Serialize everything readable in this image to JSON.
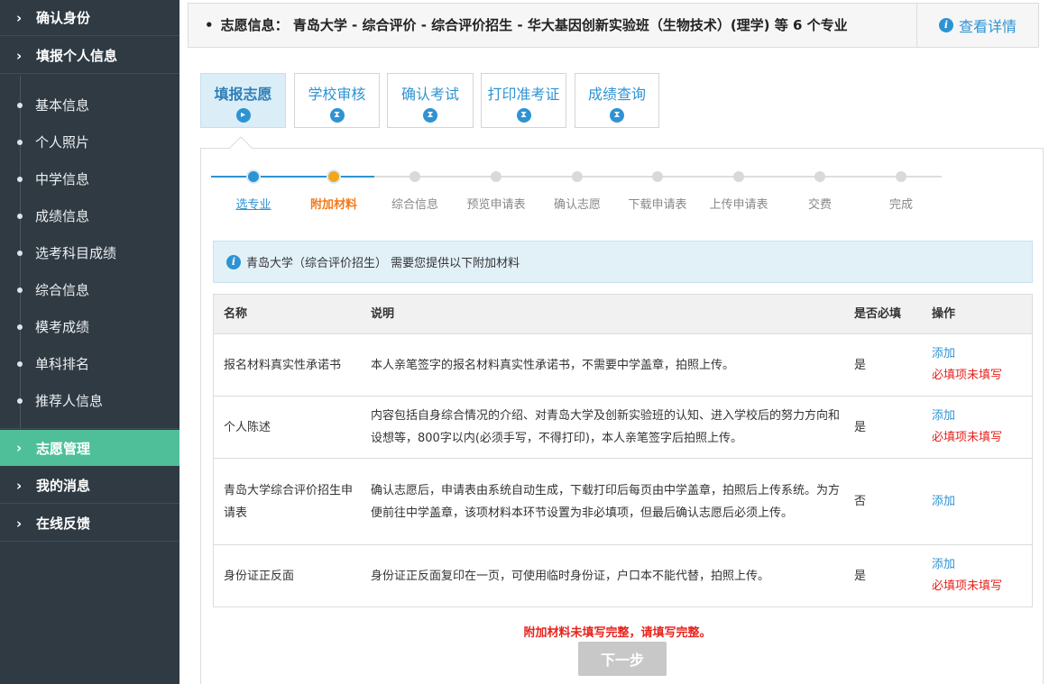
{
  "sidebar": {
    "sections": [
      {
        "label": "确认身份"
      },
      {
        "label": "填报个人信息"
      },
      {
        "label": "志愿管理",
        "active": true
      },
      {
        "label": "我的消息"
      },
      {
        "label": "在线反馈"
      }
    ],
    "sub_items": [
      {
        "label": "基本信息"
      },
      {
        "label": "个人照片"
      },
      {
        "label": "中学信息"
      },
      {
        "label": "成绩信息"
      },
      {
        "label": "选考科目成绩"
      },
      {
        "label": "综合信息"
      },
      {
        "label": "模考成绩"
      },
      {
        "label": "单科排名"
      },
      {
        "label": "推荐人信息"
      }
    ],
    "chevron": "›"
  },
  "info_bar": {
    "bullet": "•",
    "text": "志愿信息： 青岛大学 - 综合评价 - 综合评价招生 - 华大基因创新实验班（生物技术）(理学) 等 6 个专业",
    "detail_icon": "i",
    "detail_label": "查看详情"
  },
  "stage_tabs": [
    {
      "label": "填报志愿",
      "icon": "play-icon",
      "glyph": "▸",
      "active": true
    },
    {
      "label": "学校审核",
      "icon": "hourglass-icon",
      "glyph": "⧗"
    },
    {
      "label": "确认考试",
      "icon": "hourglass-icon",
      "glyph": "⧗"
    },
    {
      "label": "打印准考证",
      "icon": "hourglass-icon",
      "glyph": "⧗"
    },
    {
      "label": "成绩查询",
      "icon": "hourglass-icon",
      "glyph": "⧗"
    }
  ],
  "steps": [
    {
      "label": "选专业",
      "state": "done"
    },
    {
      "label": "附加材料",
      "state": "current"
    },
    {
      "label": "综合信息",
      "state": "pending"
    },
    {
      "label": "预览申请表",
      "state": "pending"
    },
    {
      "label": "确认志愿",
      "state": "pending"
    },
    {
      "label": "下载申请表",
      "state": "pending"
    },
    {
      "label": "上传申请表",
      "state": "pending"
    },
    {
      "label": "交费",
      "state": "pending"
    },
    {
      "label": "完成",
      "state": "pending"
    }
  ],
  "colors": {
    "done": "#2e93d3",
    "current": "#f0a818",
    "pending": "#d9d9d9",
    "line_done": "#2e93d3",
    "line_pending": "#dedede"
  },
  "notice": {
    "icon": "i",
    "text": "青岛大学（综合评价招生） 需要您提供以下附加材料"
  },
  "table": {
    "headers": {
      "name": "名称",
      "desc": "说明",
      "required": "是否必填",
      "op": "操作"
    },
    "rows": [
      {
        "name": "报名材料真实性承诺书",
        "desc": "本人亲笔签字的报名材料真实性承诺书，不需要中学盖章，拍照上传。",
        "required": "是",
        "add": "添加",
        "warn": "必填项未填写"
      },
      {
        "name": "个人陈述",
        "desc": "内容包括自身综合情况的介绍、对青岛大学及创新实验班的认知、进入学校后的努力方向和设想等，800字以内(必须手写，不得打印)，本人亲笔签字后拍照上传。",
        "required": "是",
        "add": "添加",
        "warn": "必填项未填写"
      },
      {
        "name": "青岛大学综合评价招生申请表",
        "desc": "确认志愿后，申请表由系统自动生成，下载打印后每页由中学盖章，拍照后上传系统。为方便前往中学盖章，该项材料本环节设置为非必填项，但最后确认志愿后必须上传。",
        "required": "否",
        "add": "添加",
        "warn": ""
      },
      {
        "name": "身份证正反面",
        "desc": "身份证正反面复印在一页，可使用临时身份证，户口本不能代替，拍照上传。",
        "required": "是",
        "add": "添加",
        "warn": "必填项未填写"
      }
    ]
  },
  "form_error": "附加材料未填写完整，请填写完整。",
  "next_button": "下一步"
}
